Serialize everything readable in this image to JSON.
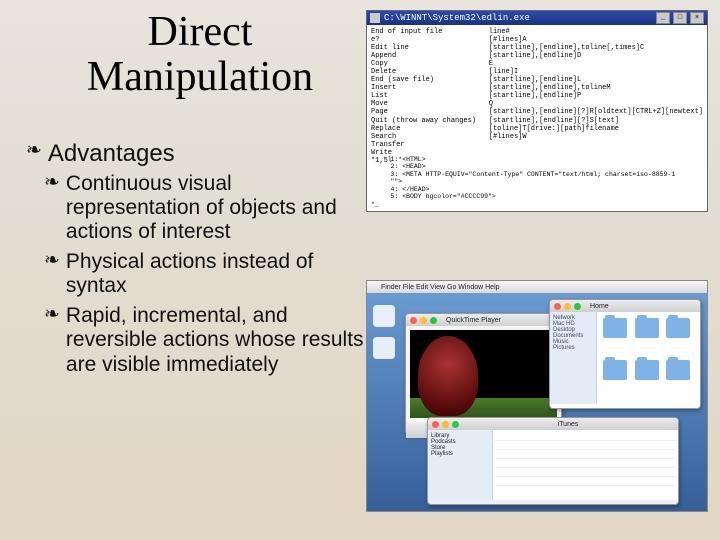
{
  "title_line1": "Direct",
  "title_line2": "Manipulation",
  "heading": "Advantages",
  "bullets": {
    "b1": "Continuous visual representation of objects and actions of interest",
    "b2": "Physical actions instead of syntax",
    "b3": "Rapid, incremental, and reversible actions whose results are visible immediately"
  },
  "bullet_glyph": "❧",
  "terminal": {
    "title": "C:\\WINNT\\System32\\edlin.exe",
    "left_col": "End of input file\ne?\nEdit line\nAppend\nCopy\nDelete\nEnd (save file)\nInsert\nList\nMove\nPage\nQuit (throw away changes)\nReplace\nSearch\nTransfer\nWrite\n*1,5l",
    "right_col": "line#\n[#lines]A\n[startline],[endline],toline[,times]C\n[startline],[endline]D\nE\n[line]I\n[startline],[endline]L\n[startline],[endline],tolineM\n[startline],[endline]P\nQ\n[startline],[endline][?]R[oldtext][CTRL+Z][newtext]\n[startline],[endline][?]S[text]\n[toline]T[drive:][path]filename\n[#lines]W",
    "lower": "     1:*<HTML>\n     2: <HEAD>\n     3: <META HTTP-EQUIV=\"Content-Type\" CONTENT=\"text/html; charset=iso-8859-1\n     \"\">\n     4: </HEAD>\n     5: <BODY bgcolor=\"#CCCC99\">\n*_",
    "btn_min": "_",
    "btn_max": "□",
    "btn_close": "×"
  },
  "desktop": {
    "menubar_apple": "",
    "menubar_items": "Finder   File   Edit   View   Go   Window   Help",
    "media_title": "QuickTime Player",
    "finder_title": "Home",
    "finder_side": "Network\nMac HD\nDesktop\nDocuments\nMusic\nPictures",
    "itunes_title": "iTunes",
    "itunes_side": "Library\nPodcasts\nStore\nPlaylists"
  }
}
